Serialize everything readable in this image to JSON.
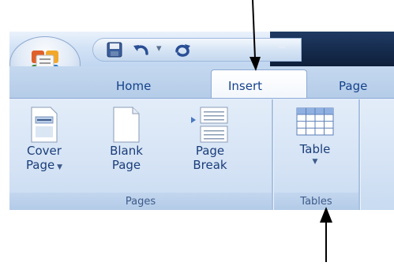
{
  "ribbon": {
    "tabs": [
      {
        "label": "Home"
      },
      {
        "label": "Insert",
        "active": true
      },
      {
        "label": "Page"
      }
    ],
    "groups": [
      {
        "name": "Pages",
        "buttons": [
          {
            "line1": "Cover",
            "line2": "Page",
            "dropdown": true,
            "icon": "cover-page-icon"
          },
          {
            "line1": "Blank",
            "line2": "Page",
            "dropdown": false,
            "icon": "blank-page-icon"
          },
          {
            "line1": "Page",
            "line2": "Break",
            "dropdown": false,
            "icon": "page-break-icon"
          }
        ]
      },
      {
        "name": "Tables",
        "buttons": [
          {
            "line1": "Table",
            "dropdown": true,
            "icon": "table-icon"
          }
        ]
      }
    ]
  },
  "quick_access": {
    "items": [
      "save-icon",
      "undo-icon",
      "redo-icon",
      "customize-icon"
    ]
  },
  "colors": {
    "tab_text": "#15428b",
    "label_text": "#1a3d7a",
    "group_footer_text": "#3e5b8a"
  }
}
